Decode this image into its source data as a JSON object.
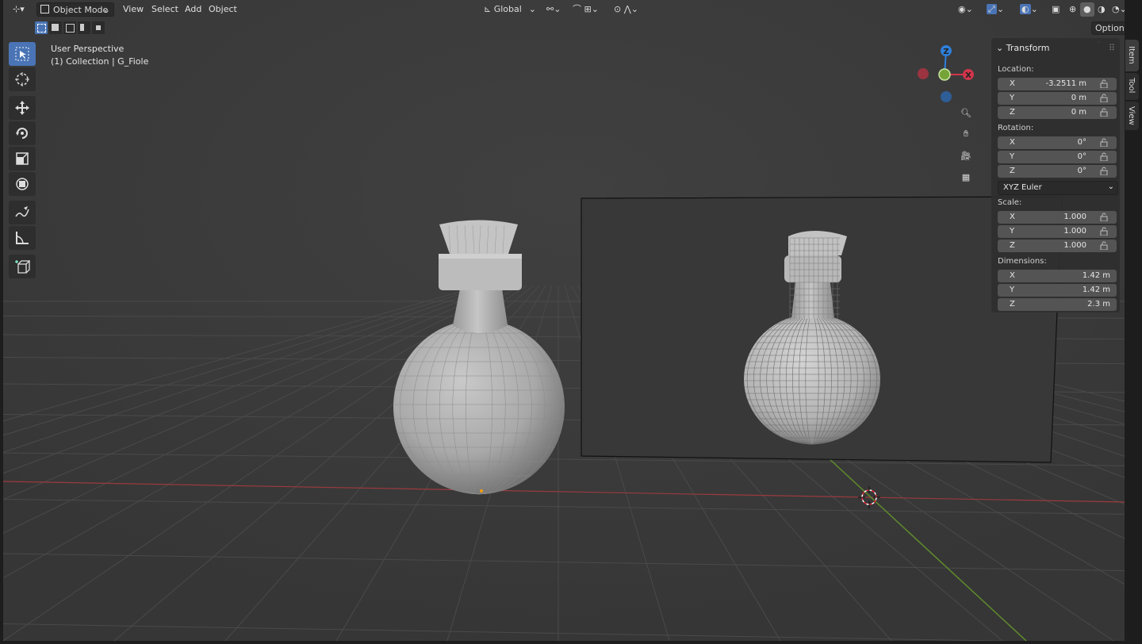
{
  "header": {
    "mode": "Object Mode",
    "menus": [
      "View",
      "Select",
      "Add",
      "Object"
    ],
    "transform_orientation": "Global",
    "options_label": "Options"
  },
  "viewport": {
    "perspective_label": "User Perspective",
    "collection_label": "(1) Collection | G_Fiole"
  },
  "gizmo": {
    "x_label": "X",
    "y_label": "Y",
    "z_label": "Z"
  },
  "transform_panel": {
    "title": "Transform",
    "location_label": "Location:",
    "location": [
      {
        "axis": "X",
        "value": "-3.2511 m"
      },
      {
        "axis": "Y",
        "value": "0 m"
      },
      {
        "axis": "Z",
        "value": "0 m"
      }
    ],
    "rotation_label": "Rotation:",
    "rotation": [
      {
        "axis": "X",
        "value": "0°"
      },
      {
        "axis": "Y",
        "value": "0°"
      },
      {
        "axis": "Z",
        "value": "0°"
      }
    ],
    "rotation_mode": "XYZ Euler",
    "scale_label": "Scale:",
    "scale": [
      {
        "axis": "X",
        "value": "1.000"
      },
      {
        "axis": "Y",
        "value": "1.000"
      },
      {
        "axis": "Z",
        "value": "1.000"
      }
    ],
    "dimensions_label": "Dimensions:",
    "dimensions": [
      {
        "axis": "X",
        "value": "1.42 m"
      },
      {
        "axis": "Y",
        "value": "1.42 m"
      },
      {
        "axis": "Z",
        "value": "2.3 m"
      }
    ]
  },
  "sidebar_tabs": [
    "Item",
    "Tool",
    "View"
  ],
  "colors": {
    "x_axis": "#d0354b",
    "y_axis": "#76a338",
    "z_axis": "#2e7fd9",
    "active_tool": "#4a74b5",
    "viewport_bg": "#3c3c3c"
  }
}
